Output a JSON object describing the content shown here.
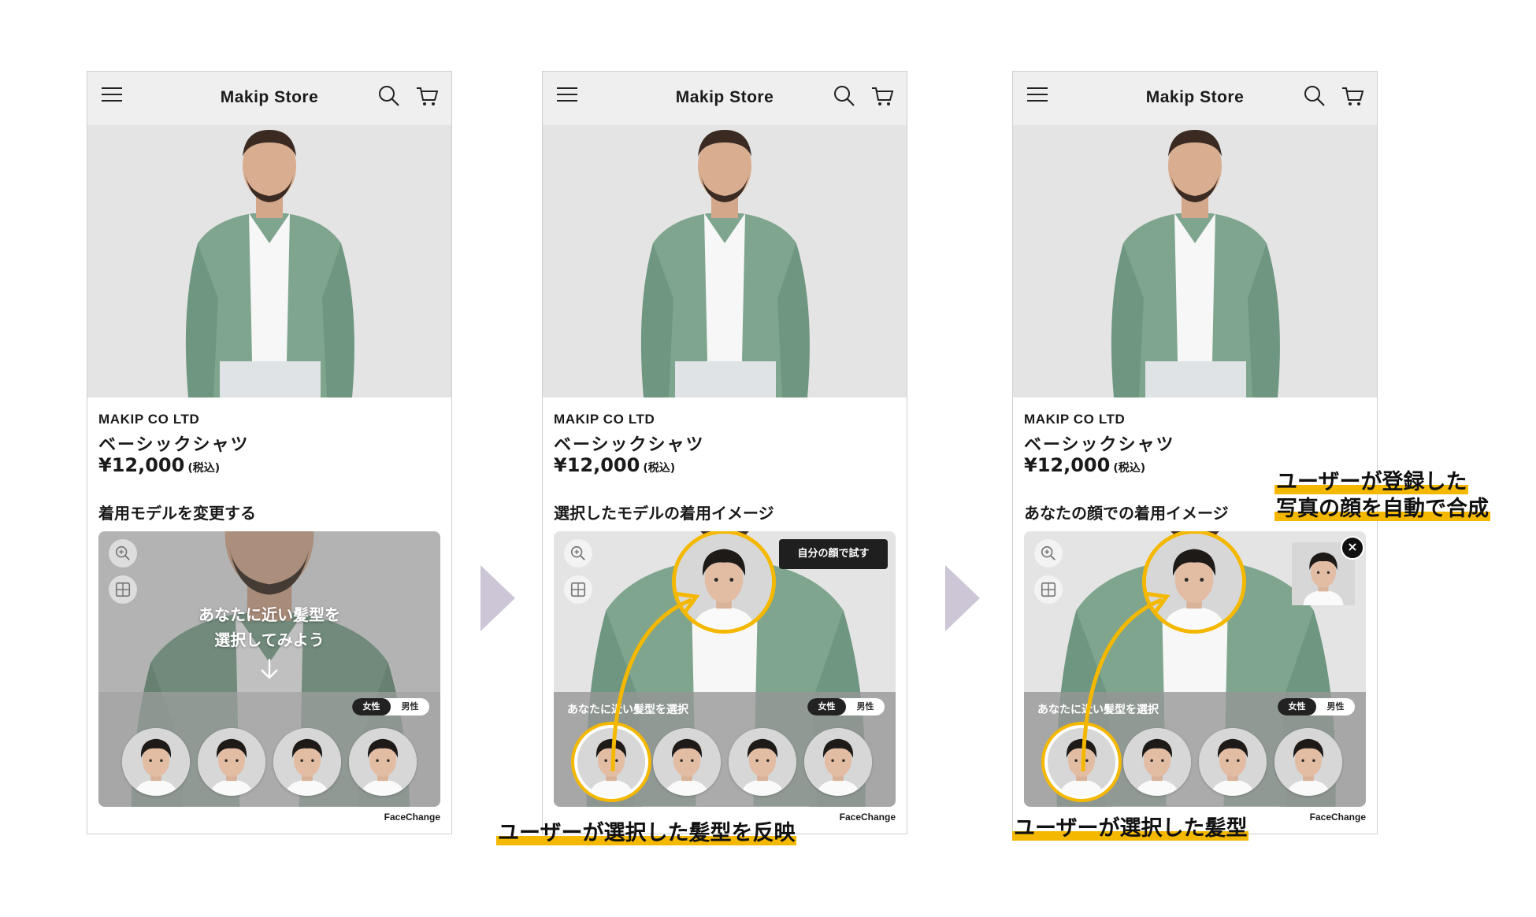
{
  "screens": [
    {
      "store_title": "Makip Store",
      "brand": "MAKIP CO LTD",
      "product_name": "ベーシックシャツ",
      "price": "¥12,000",
      "tax_label": "(税込)",
      "section_title": "着用モデルを変更する",
      "overlay_line1": "あなたに近い髪型を",
      "overlay_line2": "選択してみよう",
      "gender_female": "女性",
      "gender_male": "男性",
      "powered_by": "FaceChange"
    },
    {
      "store_title": "Makip Store",
      "brand": "MAKIP CO LTD",
      "product_name": "ベーシックシャツ",
      "price": "¥12,000",
      "tax_label": "(税込)",
      "section_title": "選択したモデルの着用イメージ",
      "try_button": "自分の顔で試す",
      "tray_label": "あなたに近い髪型を選択",
      "gender_female": "女性",
      "gender_male": "男性",
      "powered_by": "FaceChange"
    },
    {
      "store_title": "Makip Store",
      "brand": "MAKIP CO LTD",
      "product_name": "ベーシックシャツ",
      "price": "¥12,000",
      "tax_label": "(税込)",
      "section_title": "あなたの顔での着用イメージ",
      "tray_label": "あなたに近い髪型を選択",
      "gender_female": "女性",
      "gender_male": "男性",
      "powered_by": "FaceChange",
      "close_symbol": "×"
    }
  ],
  "callouts": {
    "reflect": "ユーザーが選択した髪型を反映",
    "selected": "ユーザーが選択した髪型",
    "upload_line1": "ユーザーが登録した",
    "upload_line2": "写真の顔を自動で合成"
  },
  "colors": {
    "accent": "#f5b800",
    "appbar": "#efefef",
    "shirt": "#7fa58e",
    "chevron": "#cdc6d6"
  },
  "icons": [
    "menu-icon",
    "search-icon",
    "cart-icon",
    "zoom-icon",
    "grid-icon",
    "close-icon",
    "down-arrow-icon",
    "chevron-right-icon"
  ]
}
